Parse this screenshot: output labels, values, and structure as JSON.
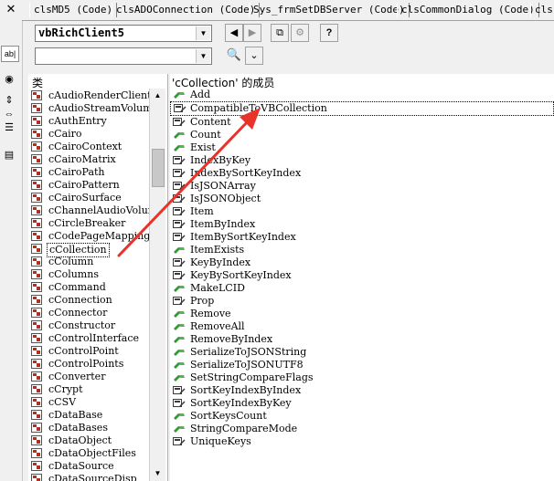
{
  "left_strip": {
    "close_glyph": "✕",
    "label_box": "ab|"
  },
  "tabs": [
    "clsMD5 (Code)",
    "clsADOConnection (Code)",
    "Sys_frmSetDBServer (Code)",
    "clsCommonDialog (Code)",
    "cls"
  ],
  "toolbar": {
    "library_value": "vbRichClient5",
    "search_value": "",
    "back_glyph": "◀",
    "forward_glyph": "▶",
    "copy_glyph": "⧉",
    "view_def_glyph": "⚙",
    "help_glyph": "?",
    "find_glyph": "🔍",
    "toggle_glyph": "⌄"
  },
  "class_panel": {
    "header": "类",
    "items": [
      "cAudioRenderClient",
      "cAudioStreamVolume",
      "cAuthEntry",
      "cCairo",
      "cCairoContext",
      "cCairoMatrix",
      "cCairoPath",
      "cCairoPattern",
      "cCairoSurface",
      "cChannelAudioVolume",
      "cCircleBreaker",
      "cCodePageMapping",
      "cCollection",
      "cColumn",
      "cColumns",
      "cCommand",
      "cConnection",
      "cConnector",
      "cConstructor",
      "cControlInterface",
      "cControlPoint",
      "cControlPoints",
      "cConverter",
      "cCrypt",
      "cCSV",
      "cDataBase",
      "cDataBases",
      "cDataObject",
      "cDataObjectFiles",
      "cDataSource",
      "cDataSourceDisp"
    ],
    "selected": "cCollection"
  },
  "member_panel": {
    "header": "'cCollection' 的成员",
    "items": [
      {
        "name": "Add",
        "kind": "method"
      },
      {
        "name": "CompatibleToVBCollection",
        "kind": "property"
      },
      {
        "name": "Content",
        "kind": "property"
      },
      {
        "name": "Count",
        "kind": "method"
      },
      {
        "name": "Exist",
        "kind": "method"
      },
      {
        "name": "IndexByKey",
        "kind": "property"
      },
      {
        "name": "IndexBySortKeyIndex",
        "kind": "property"
      },
      {
        "name": "IsJSONArray",
        "kind": "property"
      },
      {
        "name": "IsJSONObject",
        "kind": "property"
      },
      {
        "name": "Item",
        "kind": "property"
      },
      {
        "name": "ItemByIndex",
        "kind": "property"
      },
      {
        "name": "ItemBySortKeyIndex",
        "kind": "property"
      },
      {
        "name": "ItemExists",
        "kind": "method"
      },
      {
        "name": "KeyByIndex",
        "kind": "property"
      },
      {
        "name": "KeyBySortKeyIndex",
        "kind": "property"
      },
      {
        "name": "MakeLCID",
        "kind": "method"
      },
      {
        "name": "Prop",
        "kind": "property"
      },
      {
        "name": "Remove",
        "kind": "method"
      },
      {
        "name": "RemoveAll",
        "kind": "method"
      },
      {
        "name": "RemoveByIndex",
        "kind": "method"
      },
      {
        "name": "SerializeToJSONString",
        "kind": "method"
      },
      {
        "name": "SerializeToJSONUTF8",
        "kind": "method"
      },
      {
        "name": "SetStringCompareFlags",
        "kind": "method"
      },
      {
        "name": "SortKeyIndexByIndex",
        "kind": "property"
      },
      {
        "name": "SortKeyIndexByKey",
        "kind": "property"
      },
      {
        "name": "SortKeysCount",
        "kind": "method"
      },
      {
        "name": "StringCompareMode",
        "kind": "method"
      },
      {
        "name": "UniqueKeys",
        "kind": "property"
      }
    ],
    "selected": "CompatibleToVBCollection"
  },
  "colors": {
    "annotation_arrow": "#e8332a",
    "method_icon": "#2e9c2e",
    "property_icon": "#3a3a3a",
    "class_icon": "#b03020"
  }
}
